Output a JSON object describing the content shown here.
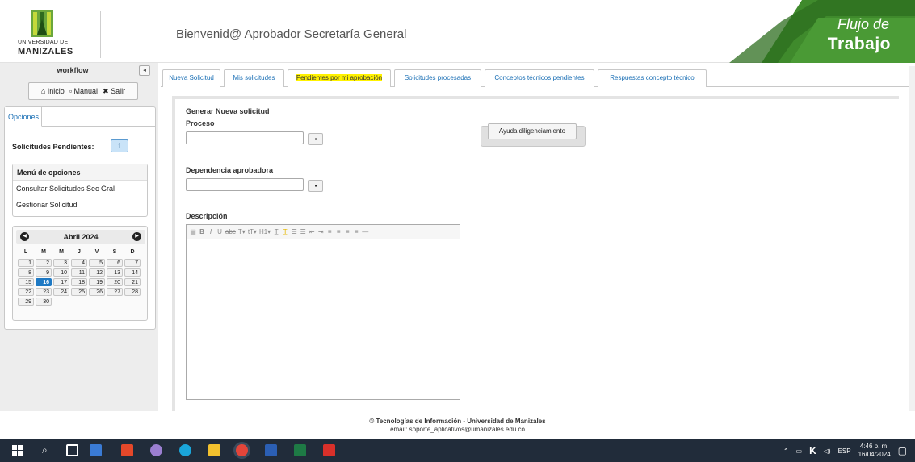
{
  "header": {
    "logo_line1": "UNIVERSIDAD DE",
    "logo_line2": "MANIZALES",
    "welcome": "Bienvenid@ Aprobador Secretaría General",
    "brand_line1": "Flujo de",
    "brand_line2": "Trabajo"
  },
  "sidebar": {
    "title": "workflow",
    "collapse_icon": "◂",
    "nav": {
      "home": "Inicio",
      "manual": "Manual",
      "exit": "Salir"
    },
    "tab": "Opciones",
    "pending_label": "Solicitudes Pendientes:",
    "pending_count": "1",
    "menu_header": "Menú de opciones",
    "menu_items": [
      "Consultar Solicitudes Sec Gral",
      "Gestionar Solicitud"
    ]
  },
  "calendar": {
    "title": "Abril 2024",
    "prev_icon": "◀",
    "next_icon": "▶",
    "day_headers": [
      "L",
      "M",
      "M",
      "J",
      "V",
      "S",
      "D"
    ],
    "weeks": [
      [
        "1",
        "2",
        "3",
        "4",
        "5",
        "6",
        "7"
      ],
      [
        "8",
        "9",
        "10",
        "11",
        "12",
        "13",
        "14"
      ],
      [
        "15",
        "16",
        "17",
        "18",
        "19",
        "20",
        "21"
      ],
      [
        "22",
        "23",
        "24",
        "25",
        "26",
        "27",
        "28"
      ],
      [
        "29",
        "30",
        "",
        "",
        "",
        "",
        ""
      ]
    ],
    "today": "16"
  },
  "tabs": [
    "Nueva Solicitud",
    "Mis solicitudes",
    "Pendientes por mi aprobación",
    "Solicitudes procesadas",
    "Conceptos técnicos pendientes",
    "Respuestas concepto técnico"
  ],
  "form": {
    "section_title": "Generar Nueva solicitud",
    "process_label": "Proceso",
    "process_value": "",
    "dependency_label": "Dependencia aprobadora",
    "dependency_value": "",
    "help_button": "Ayuda diligenciamiento",
    "description_label": "Descripción"
  },
  "footer": {
    "line1": "© Tecnologías de Información - Universidad de Manizales",
    "line2": "email: soporte_aplicativos@umanizales.edu.co"
  },
  "taskbar": {
    "language": "ESP",
    "time": "4:46 p. m.",
    "date": "16/04/2024"
  },
  "colors": {
    "brand_green": "#3f8a2c",
    "link_blue": "#1a6fb5",
    "highlight_yellow": "#fff200",
    "taskbar_bg": "#212c3a"
  }
}
